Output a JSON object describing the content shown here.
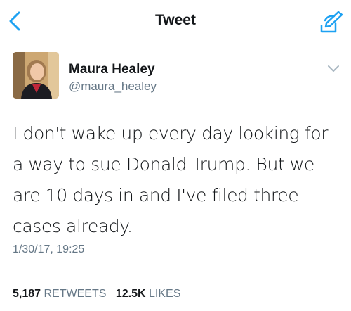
{
  "nav": {
    "title": "Tweet",
    "back_icon": "chevron-left-icon",
    "compose_icon": "compose-tweet-icon",
    "accent_color": "#1da1f2"
  },
  "tweet": {
    "author_name": "Maura Healey",
    "author_handle": "@maura_healey",
    "menu_icon": "chevron-down-icon",
    "text": "I don't wake up every day looking for a way to sue Donald Trump. But we are 10 days in and I've filed three cases already.",
    "timestamp": "1/30/17, 19:25"
  },
  "stats": {
    "retweets_count": "5,187",
    "retweets_label": "RETWEETS",
    "likes_count": "12.5K",
    "likes_label": "LIKES"
  }
}
